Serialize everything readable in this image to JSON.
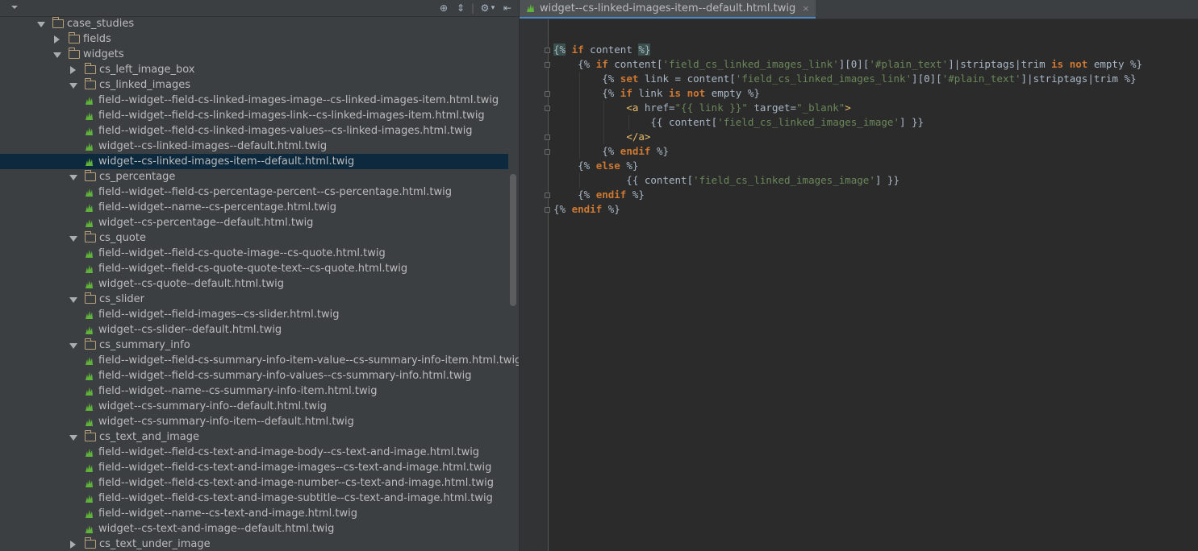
{
  "tree": [
    {
      "depth": 0,
      "type": "folder",
      "expanded": true,
      "label": "case_studies"
    },
    {
      "depth": 1,
      "type": "folder",
      "expanded": false,
      "label": "fields"
    },
    {
      "depth": 1,
      "type": "folder",
      "expanded": true,
      "label": "widgets"
    },
    {
      "depth": 2,
      "type": "folder",
      "expanded": false,
      "label": "cs_left_image_box"
    },
    {
      "depth": 2,
      "type": "folder",
      "expanded": true,
      "label": "cs_linked_images"
    },
    {
      "depth": 3,
      "type": "file",
      "label": "field--widget--field-cs-linked-images-image--cs-linked-images-item.html.twig"
    },
    {
      "depth": 3,
      "type": "file",
      "label": "field--widget--field-cs-linked-images-link--cs-linked-images-item.html.twig"
    },
    {
      "depth": 3,
      "type": "file",
      "label": "field--widget--field-cs-linked-images-values--cs-linked-images.html.twig"
    },
    {
      "depth": 3,
      "type": "file",
      "label": "widget--cs-linked-images--default.html.twig"
    },
    {
      "depth": 3,
      "type": "file",
      "label": "widget--cs-linked-images-item--default.html.twig",
      "selected": true
    },
    {
      "depth": 2,
      "type": "folder",
      "expanded": true,
      "label": "cs_percentage"
    },
    {
      "depth": 3,
      "type": "file",
      "label": "field--widget--field-cs-percentage-percent--cs-percentage.html.twig"
    },
    {
      "depth": 3,
      "type": "file",
      "label": "field--widget--name--cs-percentage.html.twig"
    },
    {
      "depth": 3,
      "type": "file",
      "label": "widget--cs-percentage--default.html.twig"
    },
    {
      "depth": 2,
      "type": "folder",
      "expanded": true,
      "label": "cs_quote"
    },
    {
      "depth": 3,
      "type": "file",
      "label": "field--widget--field-cs-quote-image--cs-quote.html.twig"
    },
    {
      "depth": 3,
      "type": "file",
      "label": "field--widget--field-cs-quote-quote-text--cs-quote.html.twig"
    },
    {
      "depth": 3,
      "type": "file",
      "label": "widget--cs-quote--default.html.twig"
    },
    {
      "depth": 2,
      "type": "folder",
      "expanded": true,
      "label": "cs_slider"
    },
    {
      "depth": 3,
      "type": "file",
      "label": "field--widget--field-images--cs-slider.html.twig"
    },
    {
      "depth": 3,
      "type": "file",
      "label": "widget--cs-slider--default.html.twig"
    },
    {
      "depth": 2,
      "type": "folder",
      "expanded": true,
      "label": "cs_summary_info"
    },
    {
      "depth": 3,
      "type": "file",
      "label": "field--widget--field-cs-summary-info-item-value--cs-summary-info-item.html.twig"
    },
    {
      "depth": 3,
      "type": "file",
      "label": "field--widget--field-cs-summary-info-values--cs-summary-info.html.twig"
    },
    {
      "depth": 3,
      "type": "file",
      "label": "field--widget--name--cs-summary-info-item.html.twig"
    },
    {
      "depth": 3,
      "type": "file",
      "label": "widget--cs-summary-info--default.html.twig"
    },
    {
      "depth": 3,
      "type": "file",
      "label": "widget--cs-summary-info-item--default.html.twig"
    },
    {
      "depth": 2,
      "type": "folder",
      "expanded": true,
      "label": "cs_text_and_image"
    },
    {
      "depth": 3,
      "type": "file",
      "label": "field--widget--field-cs-text-and-image-body--cs-text-and-image.html.twig"
    },
    {
      "depth": 3,
      "type": "file",
      "label": "field--widget--field-cs-text-and-image-images--cs-text-and-image.html.twig"
    },
    {
      "depth": 3,
      "type": "file",
      "label": "field--widget--field-cs-text-and-image-number--cs-text-and-image.html.twig"
    },
    {
      "depth": 3,
      "type": "file",
      "label": "field--widget--field-cs-text-and-image-subtitle--cs-text-and-image.html.twig"
    },
    {
      "depth": 3,
      "type": "file",
      "label": "field--widget--name--cs-text-and-image.html.twig"
    },
    {
      "depth": 3,
      "type": "file",
      "label": "widget--cs-text-and-image--default.html.twig"
    },
    {
      "depth": 2,
      "type": "folder",
      "expanded": false,
      "label": "cs_text_under_image"
    }
  ],
  "toolbar": {
    "dropdown_icon": "chevron-down-icon",
    "buttons": [
      {
        "name": "locate-icon",
        "glyph": "⊕"
      },
      {
        "name": "collapse-icon",
        "glyph": "⇕"
      },
      {
        "name": "separator",
        "glyph": "|"
      },
      {
        "name": "gear-icon",
        "glyph": "⚙"
      },
      {
        "name": "settings-arrow-icon",
        "glyph": "▾"
      },
      {
        "name": "hide-panel-icon",
        "glyph": "⇤"
      }
    ]
  },
  "editor": {
    "tab_title": "widget--cs-linked-images-item--default.html.twig",
    "tab_close": "×",
    "code": [
      [
        [
          "hl",
          "{%"
        ],
        [
          "",
          " "
        ],
        [
          "kw",
          "if"
        ],
        [
          "",
          " content "
        ],
        [
          "hl",
          "%}"
        ]
      ],
      [
        [
          "",
          "    {% "
        ],
        [
          "kw",
          "if"
        ],
        [
          "",
          " content["
        ],
        [
          "str",
          "'field_cs_linked_images_link'"
        ],
        [
          "",
          "][0]["
        ],
        [
          "str",
          "'#plain_text'"
        ],
        [
          "",
          "]|striptags|trim "
        ],
        [
          "kw",
          "is not"
        ],
        [
          "",
          " empty %}"
        ]
      ],
      [
        [
          "",
          "        {% "
        ],
        [
          "kw",
          "set"
        ],
        [
          "",
          " link = content["
        ],
        [
          "str",
          "'field_cs_linked_images_link'"
        ],
        [
          "",
          "][0]["
        ],
        [
          "str",
          "'#plain_text'"
        ],
        [
          "",
          "]|striptags|trim %}"
        ]
      ],
      [
        [
          "",
          "        {% "
        ],
        [
          "kw",
          "if"
        ],
        [
          "",
          " link "
        ],
        [
          "kw",
          "is not"
        ],
        [
          "",
          " empty %}"
        ]
      ],
      [
        [
          "",
          "            "
        ],
        [
          "tag",
          "<a "
        ],
        [
          "",
          "href="
        ],
        [
          "str",
          "\"{{ link }}\""
        ],
        [
          "",
          " target="
        ],
        [
          "str",
          "\"_blank\""
        ],
        [
          "tag",
          ">"
        ]
      ],
      [
        [
          "",
          "                {{ content["
        ],
        [
          "str",
          "'field_cs_linked_images_image'"
        ],
        [
          "",
          "] }}"
        ]
      ],
      [
        [
          "",
          "            "
        ],
        [
          "tag",
          "</a>"
        ]
      ],
      [
        [
          "",
          "        {% "
        ],
        [
          "kw",
          "endif"
        ],
        [
          "",
          " %}"
        ]
      ],
      [
        [
          "",
          "    {% "
        ],
        [
          "kw",
          "else"
        ],
        [
          "",
          " %}"
        ]
      ],
      [
        [
          "",
          "            {{ content["
        ],
        [
          "str",
          "'field_cs_linked_images_image'"
        ],
        [
          "",
          "] }}"
        ]
      ],
      [
        [
          "",
          "    {% "
        ],
        [
          "kw",
          "endif"
        ],
        [
          "",
          " %}"
        ]
      ],
      [
        [
          "",
          "{% "
        ],
        [
          "kw",
          "endif"
        ],
        [
          "",
          " %}"
        ]
      ]
    ],
    "fold_markers": [
      0,
      1,
      3,
      4,
      6,
      7,
      10,
      11
    ]
  }
}
